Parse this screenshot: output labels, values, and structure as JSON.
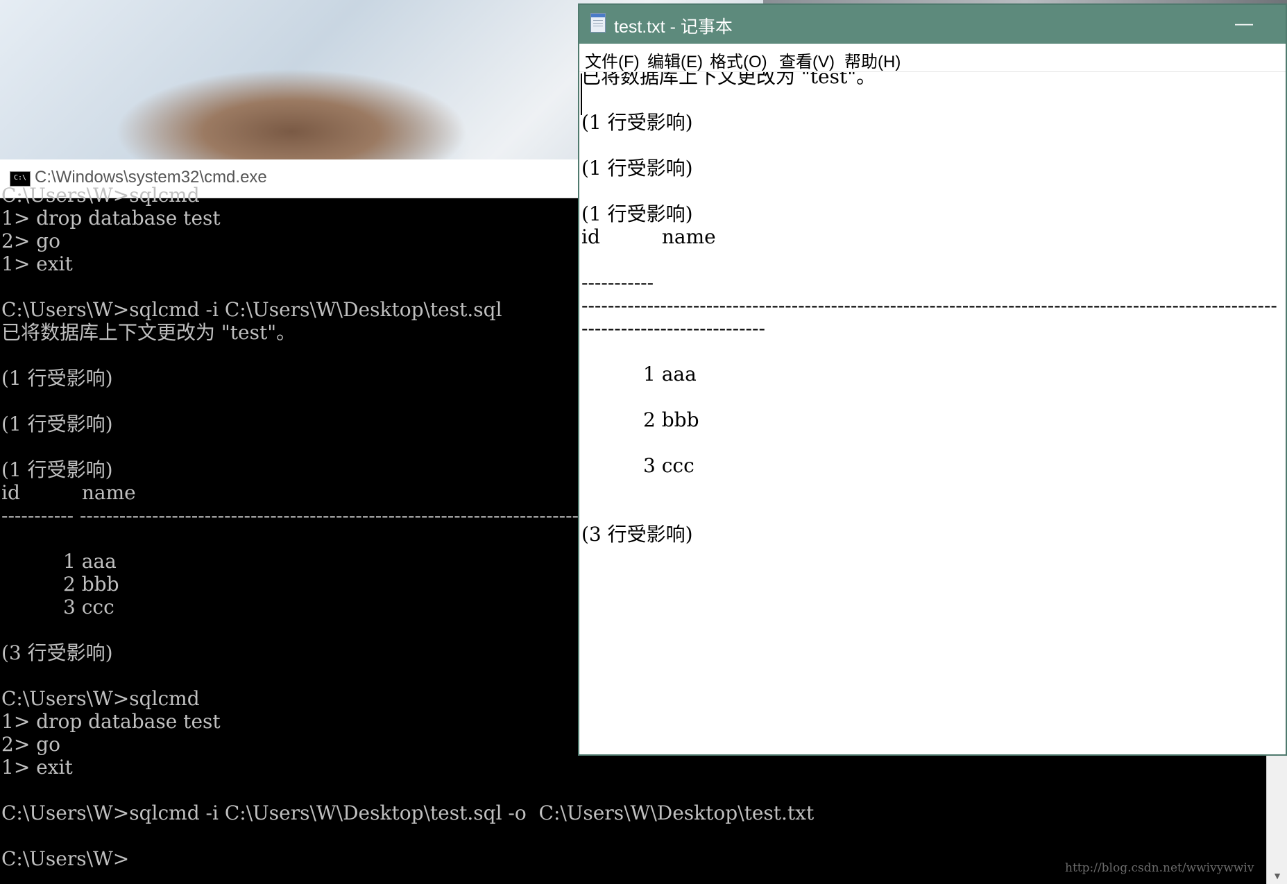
{
  "cmd": {
    "title": "C:\\Windows\\system32\\cmd.exe",
    "icon": "cmd-icon",
    "icon_text": "C:\\",
    "lines": [
      "C:\\Users\\W>sqlcmd",
      "1> drop database test",
      "2> go",
      "1> exit",
      "",
      "C:\\Users\\W>sqlcmd -i C:\\Users\\W\\Desktop\\test.sql",
      "已将数据库上下文更改为 \"test\"。",
      "",
      "(1 行受影响)",
      "",
      "(1 行受影响)",
      "",
      "(1 行受影响)",
      "id          name",
      "----------- --------------------------------------------------------------------------------------------------------------",
      "",
      "          1 aaa",
      "          2 bbb",
      "          3 ccc",
      "",
      "(3 行受影响)",
      "",
      "C:\\Users\\W>sqlcmd",
      "1> drop database test",
      "2> go",
      "1> exit",
      "",
      "C:\\Users\\W>sqlcmd -i C:\\Users\\W\\Desktop\\test.sql -o  C:\\Users\\W\\Desktop\\test.txt",
      "",
      "C:\\Users\\W>"
    ]
  },
  "notepad": {
    "title": "test.txt - 记事本",
    "menu": [
      "文件(F)",
      "编辑(E)",
      "格式(O)",
      "查看(V)",
      "帮助(H)"
    ],
    "minimize": "—",
    "lines": [
      "已将数据库上下文更改为 \"test\"。",
      "",
      "(1 行受影响)",
      "",
      "(1 行受影响)",
      "",
      "(1 行受影响)",
      "id          name",
      "",
      "-----------",
      "----------------------------------------------------------------------------------------------------------",
      "----------------------------",
      "",
      "          1 aaa",
      "",
      "          2 bbb",
      "",
      "          3 ccc",
      "",
      "",
      "(3 行受影响)"
    ]
  },
  "watermark": "http://blog.csdn.net/wwivywwiv"
}
